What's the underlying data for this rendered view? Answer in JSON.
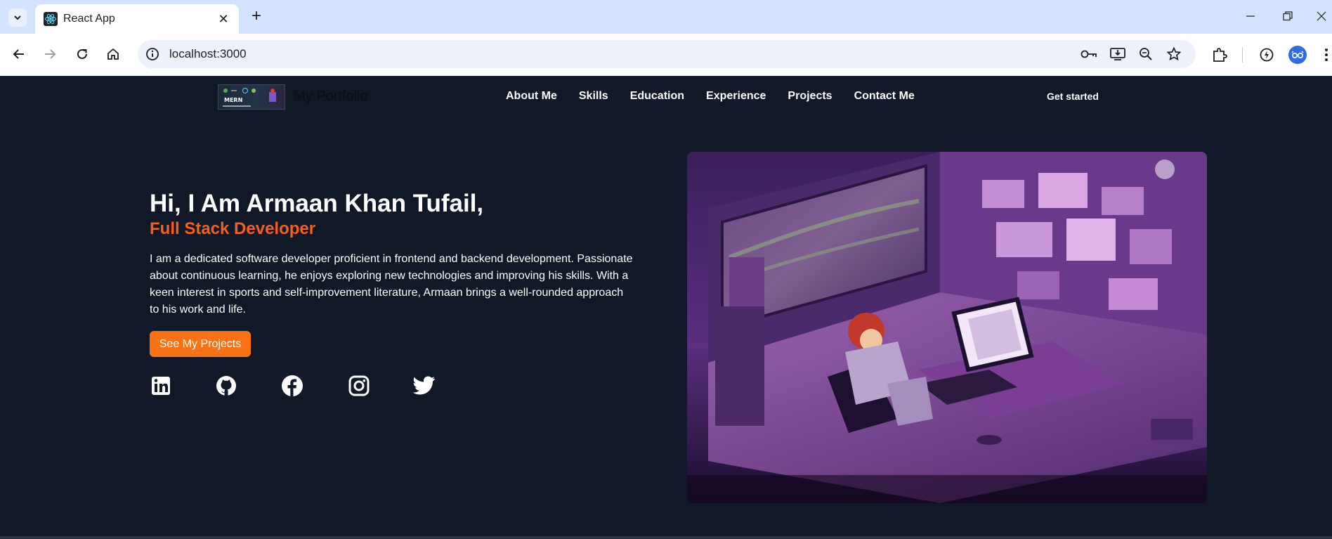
{
  "browser": {
    "tab_title": "React App",
    "url": "localhost:3000",
    "favicon": "react-icon",
    "colors": {
      "tabbar": "#d3e3fd",
      "toolbar": "#ffffff",
      "omnibox": "#edf2fa"
    }
  },
  "site": {
    "logo_text": "My Portfolio",
    "logo_image_text": "MERN",
    "nav": [
      "About Me",
      "Skills",
      "Education",
      "Experience",
      "Projects",
      "Contact Me"
    ],
    "cta": "Get started"
  },
  "hero": {
    "title": "Hi, I Am Armaan Khan Tufail,",
    "subtitle": "Full Stack Developer",
    "description": "I am a dedicated software developer proficient in frontend and backend development. Passionate about continuous learning, he enjoys exploring new technologies and improving his skills. With a keen interest in sports and self-improvement literature, Armaan brings a well-rounded approach to his work and life.",
    "button": "See My Projects",
    "socials": [
      "linkedin-icon",
      "github-icon",
      "facebook-icon",
      "instagram-icon",
      "twitter-icon"
    ],
    "image": "isometric-developer-room-illustration"
  },
  "colors": {
    "background": "#111827",
    "accent": "#f97316",
    "subtitle": "#f2611d",
    "text": "#ffffff"
  }
}
